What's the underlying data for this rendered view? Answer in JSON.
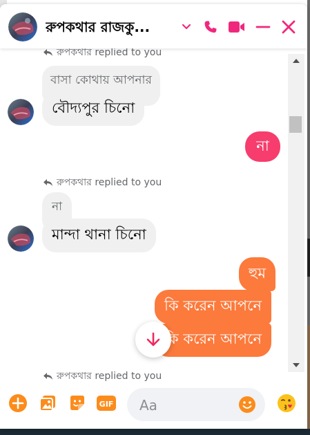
{
  "header": {
    "title": "রুপকথার রাজকু...",
    "accent": "#f0287d"
  },
  "messages": {
    "reply_note_top": "রুপকথার replied to you",
    "quoted_1": "বাসা কোথায় আপনার",
    "msg_1": "বৌদ্যপুর চিনো",
    "out_pink": "না",
    "reply_note_2": "রুপকথার replied to you",
    "quoted_2": "না",
    "msg_2": "মান্দা থানা চিনো",
    "out_1": "হুম",
    "out_2": "কি করেন আপনে",
    "out_3": "কি করেন আপনে",
    "reply_note_3": "রুপকথার replied to you"
  },
  "composer": {
    "placeholder": "Aa"
  },
  "colors": {
    "outgoing": "#fc7a3c",
    "outgoing_alt": "#f63d6d",
    "incoming": "#f0f0f0",
    "icons_orange": "#fb8c1c"
  }
}
